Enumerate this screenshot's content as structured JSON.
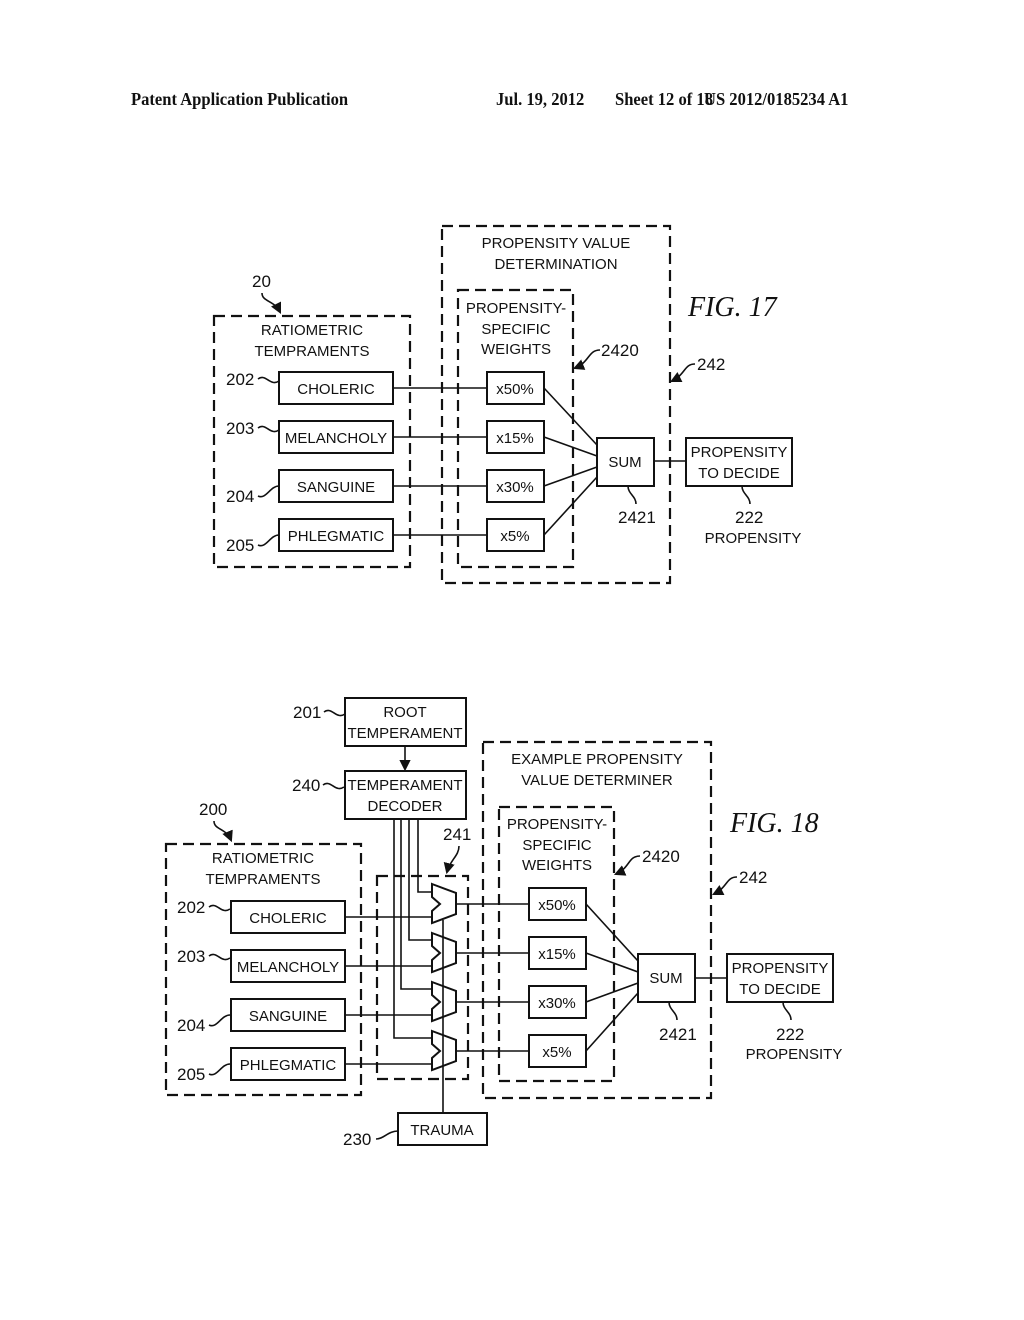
{
  "header": {
    "publication": "Patent Application Publication",
    "date": "Jul. 19, 2012",
    "sheet": "Sheet 12 of 18",
    "number": "US 2012/0185234 A1"
  },
  "fig17": {
    "title": "FIG. 17",
    "group_ref": "20",
    "group_label": [
      "RATIOMETRIC",
      "TEMPRAMENTS"
    ],
    "temperaments": [
      {
        "ref": "202",
        "label": "CHOLERIC"
      },
      {
        "ref": "203",
        "label": "MELANCHOLY"
      },
      {
        "ref": "204",
        "label": "SANGUINE"
      },
      {
        "ref": "205",
        "label": "PHLEGMATIC"
      }
    ],
    "determination_label": [
      "PROPENSITY VALUE",
      "DETERMINATION"
    ],
    "determination_ref": "242",
    "weights_label": [
      "PROPENSITY-",
      "SPECIFIC",
      "WEIGHTS"
    ],
    "weights_ref": "2420",
    "weights": [
      "x50%",
      "x15%",
      "x30%",
      "x5%"
    ],
    "sum_label": "SUM",
    "sum_ref": "2421",
    "output_label": [
      "PROPENSITY",
      "TO DECIDE"
    ],
    "output_ref": "222",
    "output_caption": "PROPENSITY"
  },
  "fig18": {
    "title": "FIG. 18",
    "root_ref": "201",
    "root_label": [
      "ROOT",
      "TEMPERAMENT"
    ],
    "decoder_ref": "240",
    "decoder_label": [
      "TEMPERAMENT",
      "DECODER"
    ],
    "group_ref": "200",
    "group_label": [
      "RATIOMETRIC",
      "TEMPRAMENTS"
    ],
    "mux_ref": "241",
    "temperaments": [
      {
        "ref": "202",
        "label": "CHOLERIC"
      },
      {
        "ref": "203",
        "label": "MELANCHOLY"
      },
      {
        "ref": "204",
        "label": "SANGUINE"
      },
      {
        "ref": "205",
        "label": "PHLEGMATIC"
      }
    ],
    "determiner_label": [
      "EXAMPLE PROPENSITY",
      "VALUE DETERMINER"
    ],
    "determiner_ref": "242",
    "weights_label": [
      "PROPENSITY-",
      "SPECIFIC",
      "WEIGHTS"
    ],
    "weights_ref": "2420",
    "weights": [
      "x50%",
      "x15%",
      "x30%",
      "x5%"
    ],
    "sum_label": "SUM",
    "sum_ref": "2421",
    "output_label": [
      "PROPENSITY",
      "TO DECIDE"
    ],
    "output_ref": "222",
    "output_caption": "PROPENSITY",
    "trauma_ref": "230",
    "trauma_label": "TRAUMA"
  }
}
